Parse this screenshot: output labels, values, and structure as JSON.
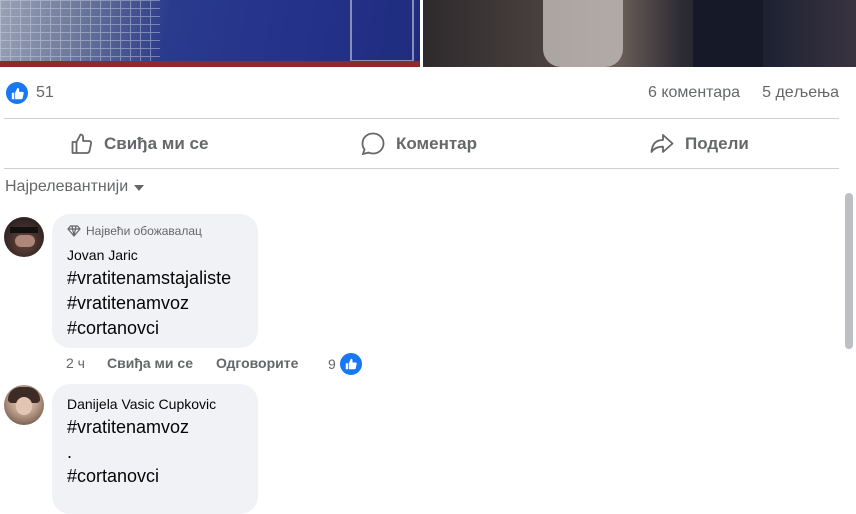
{
  "post": {
    "reaction_count": "51",
    "comments_count": "6 коментара",
    "shares_count": "5 дељења"
  },
  "actions": {
    "like_label": "Свиђа ми се",
    "comment_label": "Коментар",
    "share_label": "Подели"
  },
  "comments_sort": {
    "label": "Најрелевантнији"
  },
  "comments": [
    {
      "badge": "Највећи обожавалац",
      "author": "Jovan Jaric",
      "lines": [
        "#vratitenamstajaliste",
        "#vratitenamvoz",
        "#cortanovci"
      ],
      "time": "2 ч",
      "like_label": "Свиђа ми се",
      "reply_label": "Одговорите",
      "reaction_count": "9"
    },
    {
      "author": "Danijela Vasic Cupkovic",
      "lines": [
        "#vratitenamvoz",
        ".",
        "#cortanovci"
      ]
    }
  ],
  "icons": {
    "reaction": "like-icon",
    "like_action": "thumbs-up-icon",
    "comment_action": "speech-bubble-icon",
    "share_action": "share-arrow-icon",
    "badge": "diamond-icon",
    "sort": "caret-down-icon"
  },
  "colors": {
    "accent": "#1877f2",
    "muted_text": "#65676b",
    "bubble_bg": "#f0f2f5"
  }
}
